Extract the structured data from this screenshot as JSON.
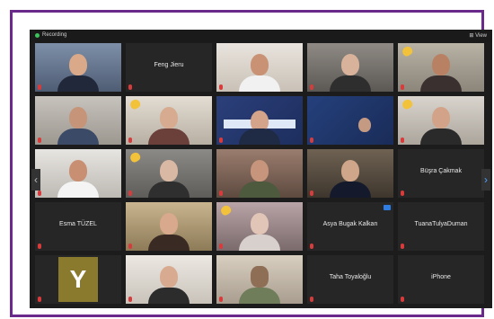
{
  "window": {
    "recording_label": "Recording",
    "view_label": "⊞ View"
  },
  "colors": {
    "frame": "#6a2a8c",
    "window_bg": "#1c1c1c",
    "tile_bg": "#262626",
    "recording_dot": "#3cc35b",
    "raised_hand": "#f2c23a",
    "muted_mic": "#d83b3b"
  },
  "tiles": {
    "r1c2": {
      "name": "Feng Jieru"
    },
    "r3c5": {
      "name": "Büşra Çakmak"
    },
    "r4c1": {
      "name": "Esma TÜZEL"
    },
    "r4c4": {
      "name": "Asya Bugak Kalkan"
    },
    "r4c5": {
      "name": "TuanaTulyaDuman"
    },
    "r5c1": {
      "avatar_letter": "Y"
    },
    "r5c4": {
      "name": "Taha Toyaloğlu"
    },
    "r5c5": {
      "name": "iPhone"
    }
  },
  "icons": {
    "left_arrow": "‹",
    "right_arrow": "›"
  }
}
